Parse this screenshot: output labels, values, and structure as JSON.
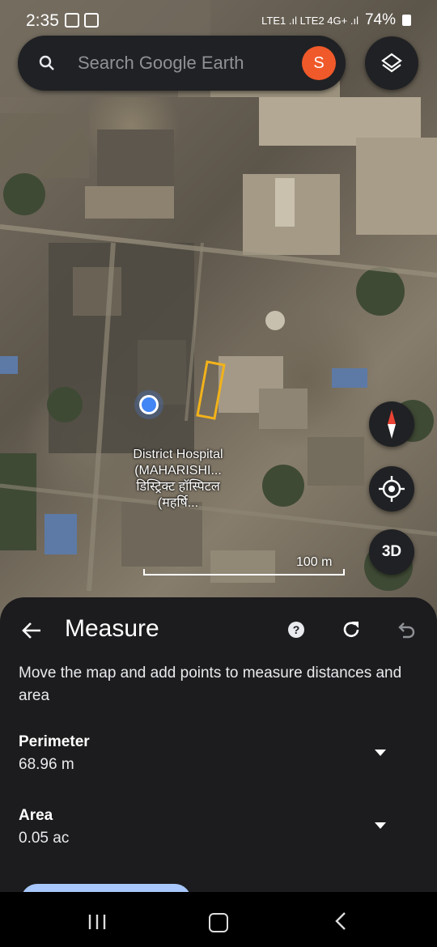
{
  "status_bar": {
    "time": "2:35",
    "network": "LTE1 .ıl LTE2 4G+ .ıl",
    "battery": "74%"
  },
  "search": {
    "placeholder": "Search Google Earth",
    "avatar_letter": "S",
    "avatar_color": "#f0592a"
  },
  "map": {
    "place_label": "District Hospital (MAHARISHI... डिस्ट्रिक्ट हॉस्पिटल (महर्षि...",
    "scale_label": "100 m",
    "three_d_label": "3D",
    "measure_outline_color": "#f2b21a",
    "location_dot_color": "#4285f4"
  },
  "measure_panel": {
    "title": "Measure",
    "help_label": "?",
    "instructions": "Move the map and add points to measure distances and area",
    "perimeter_label": "Perimeter",
    "perimeter_value": "68.96 m",
    "area_label": "Area",
    "area_value": "0.05 ac"
  },
  "icons": [
    "search-icon",
    "layers-icon",
    "compass-icon",
    "my-location-icon",
    "back-arrow-icon",
    "help-icon",
    "redo-icon",
    "undo-icon",
    "chevron-down-icon",
    "recents-icon",
    "home-icon",
    "nav-back-icon"
  ]
}
